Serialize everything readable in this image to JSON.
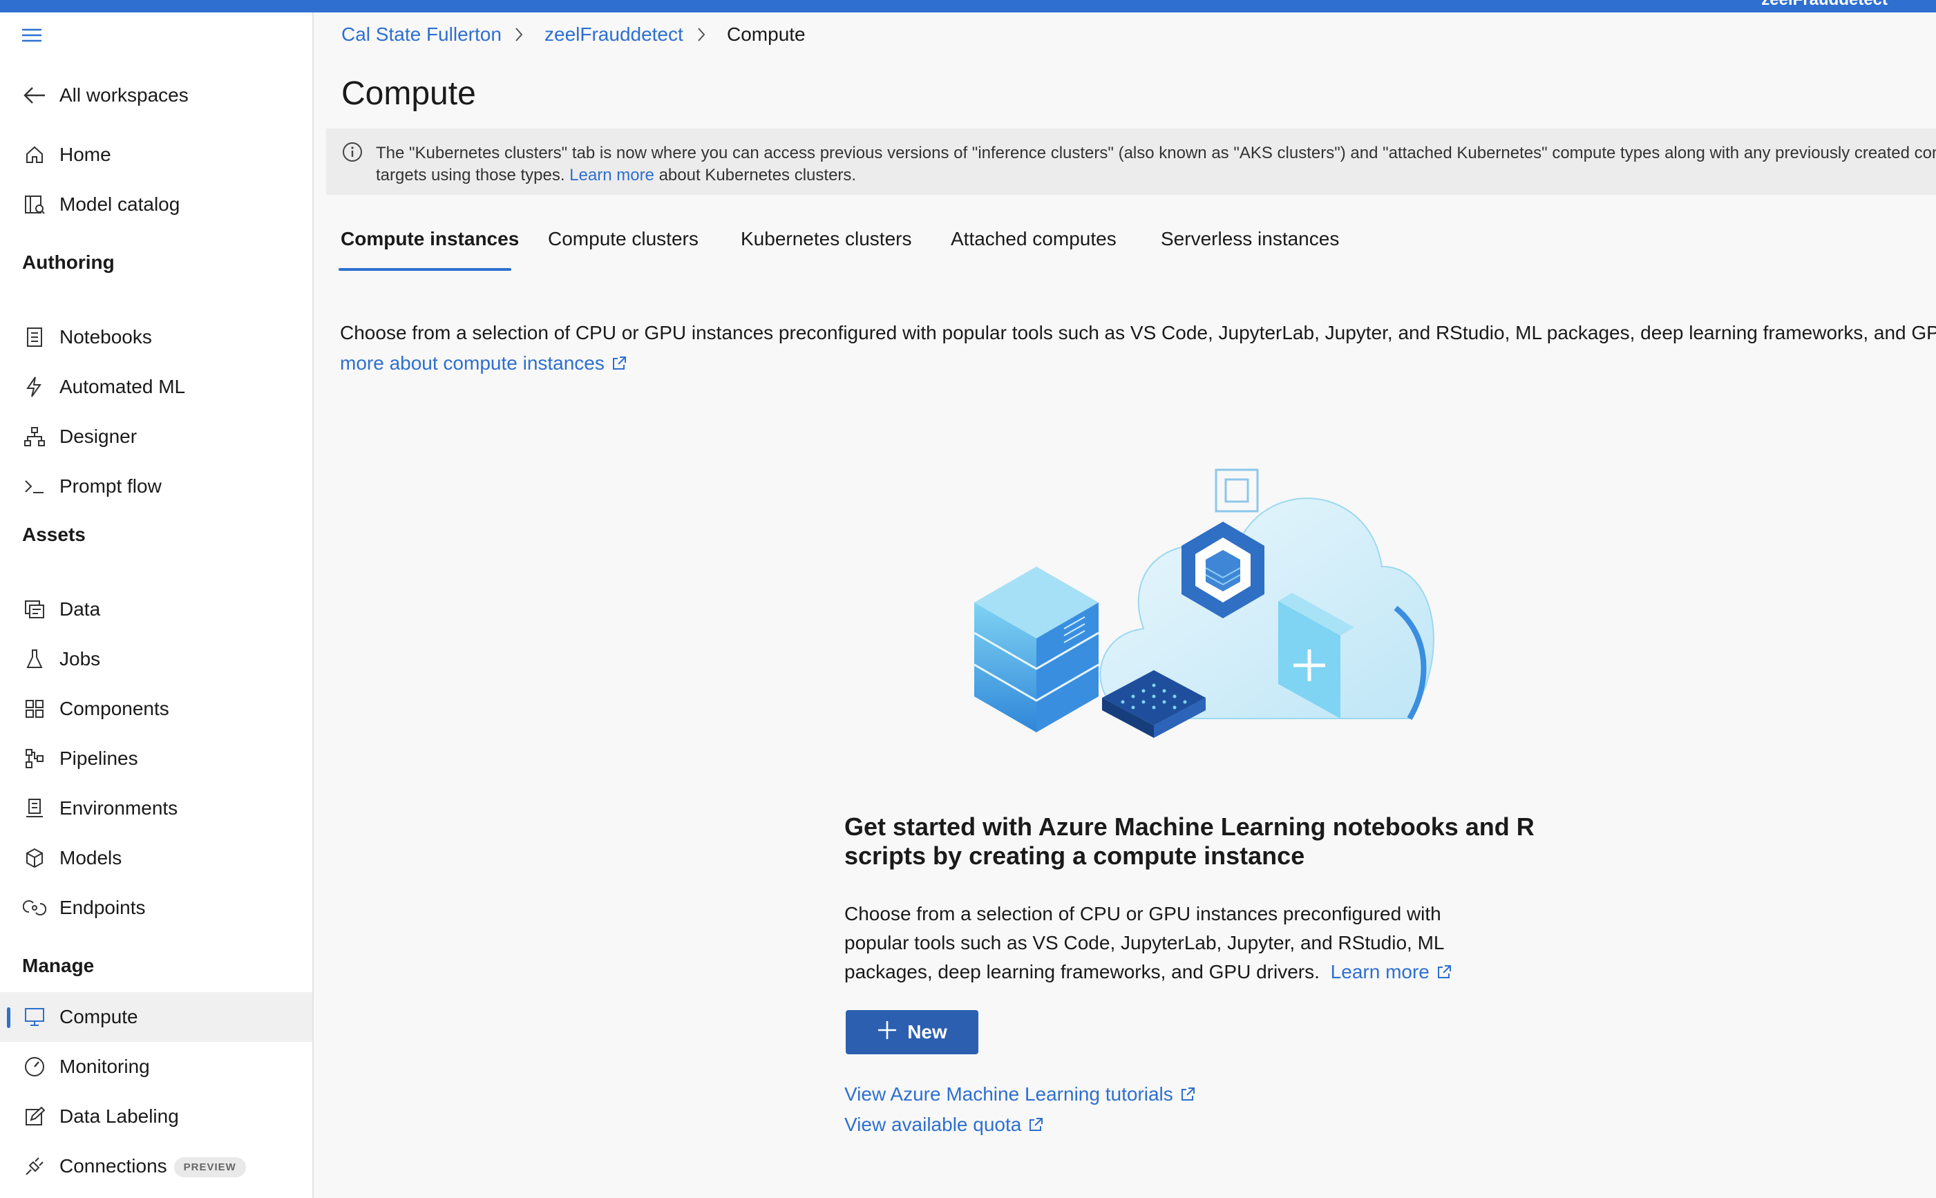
{
  "topbar": {
    "workspace": "zeelFrauddetect"
  },
  "sidebar": {
    "all_workspaces": "All workspaces",
    "items_top": [
      {
        "label": "Home",
        "icon": "home-icon"
      },
      {
        "label": "Model catalog",
        "icon": "model-catalog-icon"
      }
    ],
    "sections": {
      "authoring": "Authoring",
      "assets": "Assets",
      "manage": "Manage"
    },
    "authoring_items": [
      {
        "label": "Notebooks",
        "icon": "notebook-icon"
      },
      {
        "label": "Automated ML",
        "icon": "lightning-icon"
      },
      {
        "label": "Designer",
        "icon": "designer-icon"
      },
      {
        "label": "Prompt flow",
        "icon": "prompt-icon"
      }
    ],
    "assets_items": [
      {
        "label": "Data",
        "icon": "data-icon"
      },
      {
        "label": "Jobs",
        "icon": "flask-icon"
      },
      {
        "label": "Components",
        "icon": "components-icon"
      },
      {
        "label": "Pipelines",
        "icon": "pipeline-icon"
      },
      {
        "label": "Environments",
        "icon": "environment-icon"
      },
      {
        "label": "Models",
        "icon": "cube-icon"
      },
      {
        "label": "Endpoints",
        "icon": "endpoint-icon"
      }
    ],
    "manage_items": [
      {
        "label": "Compute",
        "icon": "monitor-icon",
        "selected": true
      },
      {
        "label": "Monitoring",
        "icon": "gauge-icon"
      },
      {
        "label": "Data Labeling",
        "icon": "edit-icon"
      },
      {
        "label": "Connections",
        "icon": "plug-icon",
        "badge": "PREVIEW"
      }
    ]
  },
  "breadcrumb": [
    "Cal State Fullerton",
    "zeelFrauddetect",
    "Compute"
  ],
  "page_title": "Compute",
  "banner": {
    "text_1": "The \"Kubernetes clusters\" tab is now where you can access previous versions of \"inference clusters\" (also known as \"AKS clusters\") and \"attached Kubernetes\" compute types along with any previously created compute",
    "text_2": "targets using those types.",
    "link": "Learn more",
    "text_3": "about Kubernetes clusters."
  },
  "tabs": [
    "Compute instances",
    "Compute clusters",
    "Kubernetes clusters",
    "Attached computes",
    "Serverless instances"
  ],
  "description": {
    "line_1": "Choose from a selection of CPU or GPU instances preconfigured with popular tools such as VS Code, JupyterLab, Jupyter, and RStudio, ML packages, deep learning frameworks, and GPU dr",
    "link": "more about compute instances"
  },
  "get_started": {
    "title": "Get started with Azure Machine Learning notebooks and R scripts by creating a compute instance",
    "desc": "Choose from a selection of CPU or GPU instances preconfigured with popular tools such as VS Code, JupyterLab, Jupyter, and RStudio, ML packages, deep learning frameworks, and GPU drivers.",
    "learn_more": "Learn more",
    "new_button": "New",
    "tutorials_link": "View Azure Machine Learning tutorials",
    "quota_link": "View available quota"
  },
  "colors": {
    "accent": "#2e6fd0",
    "button": "#2c5fb0"
  }
}
